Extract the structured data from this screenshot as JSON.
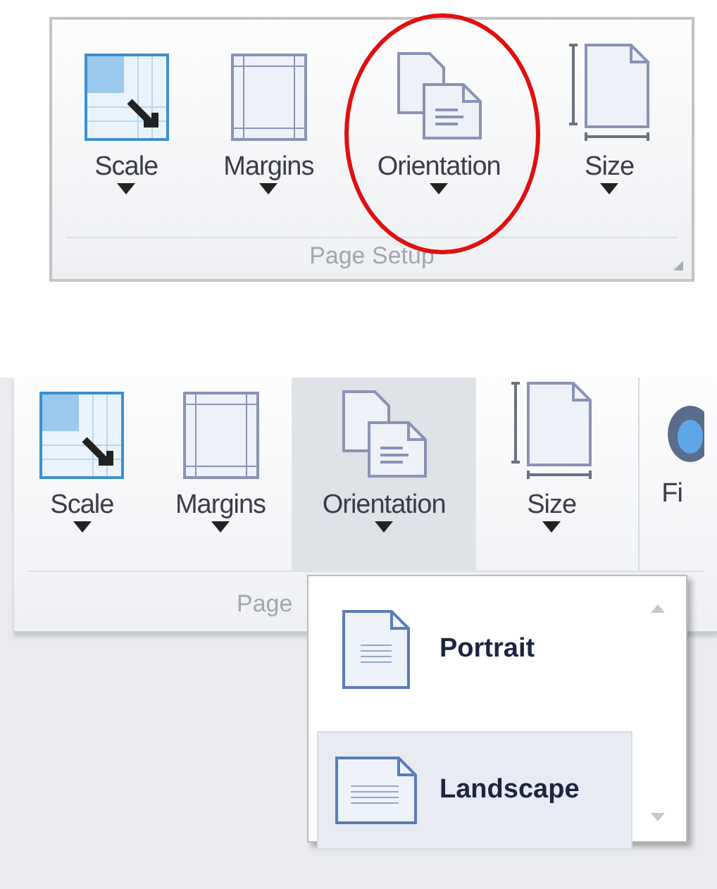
{
  "top_panel": {
    "buttons": [
      {
        "label": "Scale",
        "kind": "scale",
        "circled": false
      },
      {
        "label": "Margins",
        "kind": "margins",
        "circled": false
      },
      {
        "label": "Orientation",
        "kind": "orientation",
        "circled": true
      },
      {
        "label": "Size",
        "kind": "size",
        "circled": false
      }
    ],
    "group_label": "Page Setup"
  },
  "bottom_panel": {
    "buttons": [
      {
        "label": "Scale",
        "kind": "scale",
        "selected": false
      },
      {
        "label": "Margins",
        "kind": "margins",
        "selected": false
      },
      {
        "label": "Orientation",
        "kind": "orientation",
        "selected": true
      },
      {
        "label": "Size",
        "kind": "size",
        "selected": false
      }
    ],
    "next_button": {
      "label": "Fi"
    },
    "group_label": "Page",
    "dropdown": {
      "items": [
        {
          "label": "Portrait",
          "kind": "portrait",
          "selected": false
        },
        {
          "label": "Landscape",
          "kind": "landscape",
          "selected": true
        }
      ]
    }
  }
}
